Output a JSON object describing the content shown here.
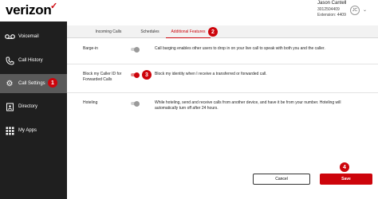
{
  "header": {
    "logo_text": "verizon",
    "logo_check": "✓",
    "user_name": "Jason Cantell",
    "user_phone": "3012504409",
    "user_extension": "Extension: 4409",
    "avatar_initials": "JC",
    "chevron": "⌄"
  },
  "sidebar": {
    "items": [
      {
        "label": "Voicemail",
        "icon": "voicemail-icon",
        "glyph": "◦◦"
      },
      {
        "label": "Call History",
        "icon": "phone-icon",
        "glyph": "☎"
      },
      {
        "label": "Call Settings",
        "icon": "gear-icon",
        "glyph": "⚙"
      },
      {
        "label": "Directory",
        "icon": "directory-icon",
        "glyph": "▦"
      },
      {
        "label": "My Apps",
        "icon": "grid-icon",
        "glyph": "⋮⋮⋮"
      }
    ]
  },
  "tabs": [
    {
      "label": "Incoming Calls"
    },
    {
      "label": "Schedules"
    },
    {
      "label": "Additional Features"
    }
  ],
  "rows": [
    {
      "label": "Barge-in",
      "desc_lines": [
        "Call barging enables other users to drop in on your live call to speak with both you and the caller."
      ],
      "toggle": "off"
    },
    {
      "label_lines": [
        "Block my Caller ID for",
        "Forwarded Calls"
      ],
      "desc_lines": [
        "Block my identity when I receive a transferred or forwarded call."
      ],
      "toggle": "on"
    },
    {
      "label": "Hoteling",
      "desc_lines": [
        "While hoteling, send and receive calls from another device, and have it be from your number. Hoteling will",
        "automatically turn off after 24 hours."
      ],
      "toggle": "off"
    }
  ],
  "buttons": {
    "cancel": "Cancel",
    "save": "Save"
  },
  "steps": [
    "1",
    "2",
    "3",
    "4"
  ],
  "colors": {
    "brand_red": "#cd040b",
    "sidebar_bg": "#1f1f1f",
    "sidebar_active": "#5a5a5a"
  }
}
